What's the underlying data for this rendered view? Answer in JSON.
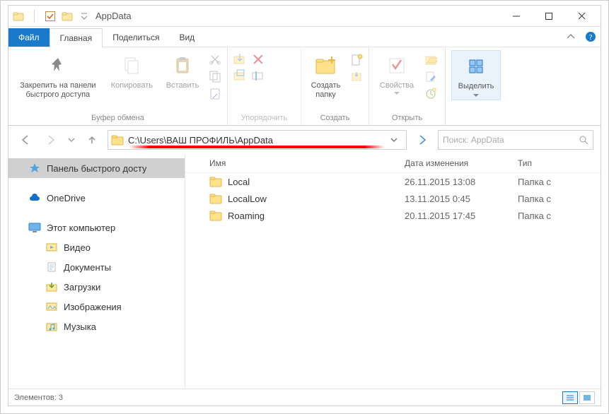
{
  "window": {
    "title": "AppData"
  },
  "tabs": {
    "file": "Файл",
    "home": "Главная",
    "share": "Поделиться",
    "view": "Вид"
  },
  "ribbon": {
    "group_clipboard_label": "Буфер обмена",
    "group_organize_label": "Упорядочить",
    "group_new_label": "Создать",
    "group_open_label": "Открыть",
    "group_select_label": "",
    "pin_label": "Закрепить на панели\nбыстрого доступа",
    "copy_label": "Копировать",
    "paste_label": "Вставить",
    "newfolder_label": "Создать\nпапку",
    "properties_label": "Свойства",
    "select_label": "Выделить"
  },
  "address": {
    "path": "C:\\Users\\ВАШ ПРОФИЛЬ\\AppData"
  },
  "search": {
    "placeholder": "Поиск: AppData"
  },
  "tree": {
    "quick_access": "Панель быстрого досту",
    "onedrive": "OneDrive",
    "this_pc": "Этот компьютер",
    "videos": "Видео",
    "documents": "Документы",
    "downloads": "Загрузки",
    "pictures": "Изображения",
    "music": "Музыка"
  },
  "columns": {
    "name": "Имя",
    "date": "Дата изменения",
    "type": "Тип"
  },
  "rows": [
    {
      "name": "Local",
      "date": "26.11.2015 13:08",
      "type": "Папка с"
    },
    {
      "name": "LocalLow",
      "date": "13.11.2015 0:45",
      "type": "Папка с"
    },
    {
      "name": "Roaming",
      "date": "20.11.2015 17:45",
      "type": "Папка с"
    }
  ],
  "status": {
    "text": "Элементов: 3"
  }
}
